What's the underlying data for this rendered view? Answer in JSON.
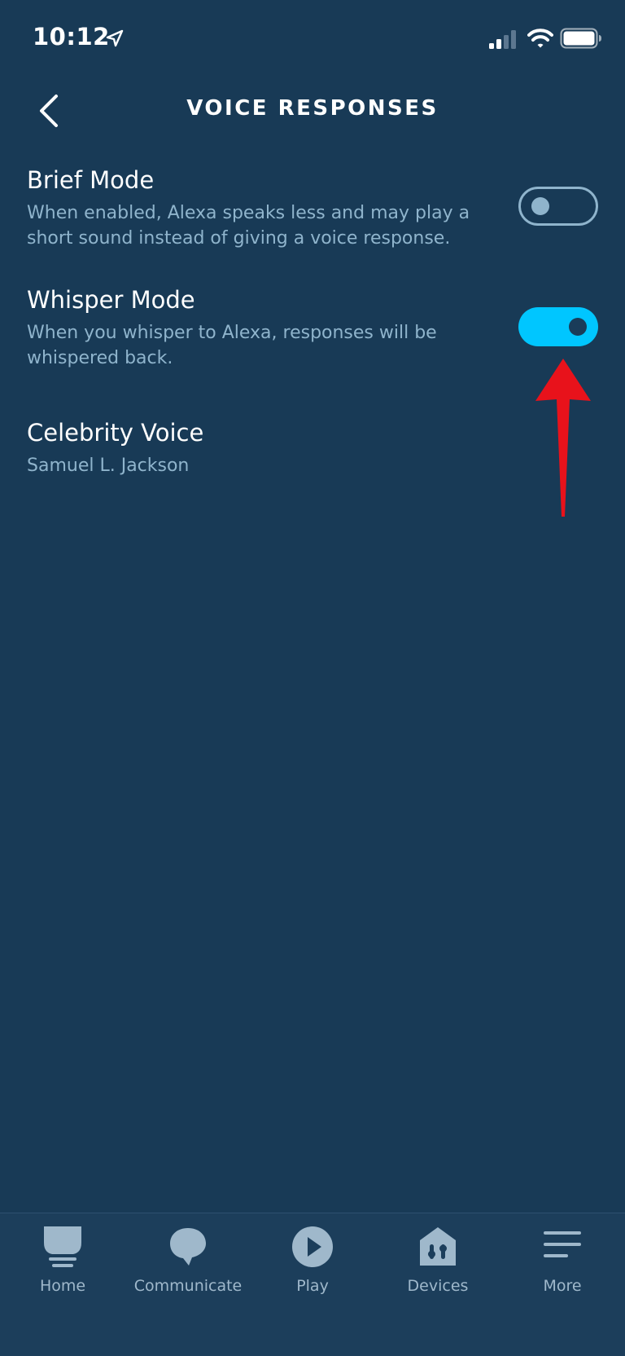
{
  "status_bar": {
    "time": "10:12",
    "icons": [
      "location-arrow-icon",
      "cellular-signal-icon",
      "wifi-icon",
      "battery-icon"
    ]
  },
  "header": {
    "title": "VOICE RESPONSES",
    "back_icon": "chevron-left-icon"
  },
  "settings": [
    {
      "title": "Brief Mode",
      "description": "When enabled, Alexa speaks less and may play a short sound instead of giving a voice response.",
      "toggle": "off"
    },
    {
      "title": "Whisper Mode",
      "description": "When you whisper to Alexa, responses will be whispered back.",
      "toggle": "on"
    },
    {
      "title": "Celebrity Voice",
      "value": "Samuel L. Jackson"
    }
  ],
  "annotation": {
    "icon": "red-arrow-icon",
    "color": "#e8121b"
  },
  "bottom_nav": [
    {
      "label": "Home",
      "icon": "home-icon"
    },
    {
      "label": "Communicate",
      "icon": "chat-bubble-icon"
    },
    {
      "label": "Play",
      "icon": "play-icon"
    },
    {
      "label": "Devices",
      "icon": "devices-icon"
    },
    {
      "label": "More",
      "icon": "menu-icon"
    }
  ],
  "colors": {
    "background": "#183a56",
    "accent": "#00c6ff",
    "secondary_text": "#8fb4cc",
    "nav_background": "#1c3e5b"
  }
}
